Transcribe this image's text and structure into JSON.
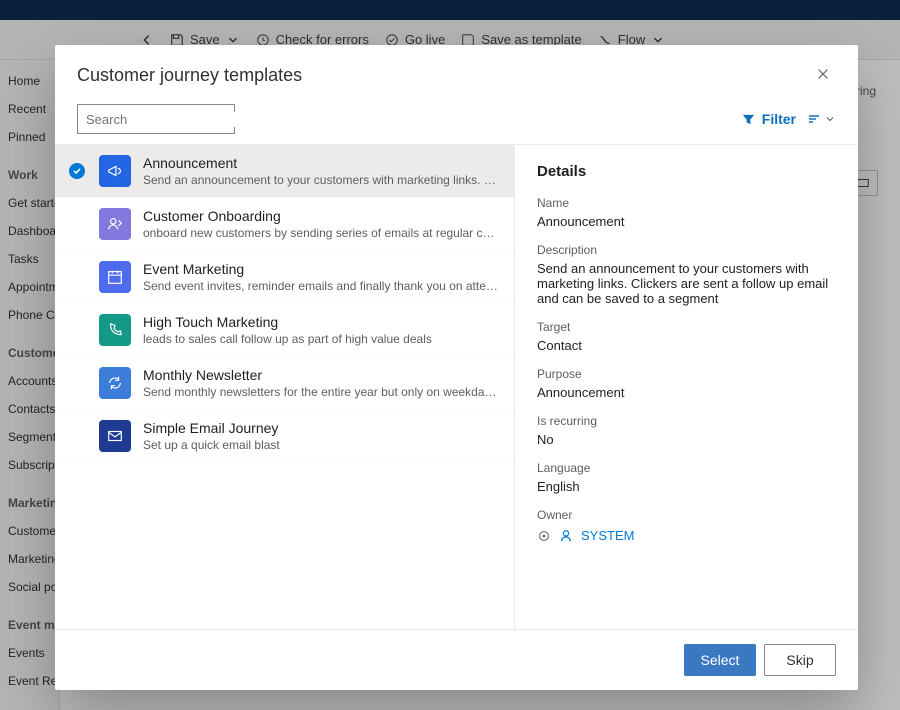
{
  "background": {
    "commands": {
      "save": "Save",
      "check": "Check for errors",
      "golive": "Go live",
      "saveas": "Save as template",
      "flow": "Flow"
    },
    "sidebar": {
      "home": "Home",
      "recent": "Recent",
      "pinned": "Pinned",
      "section_work": "Work",
      "getstarted": "Get started",
      "dashboards": "Dashboards",
      "tasks": "Tasks",
      "appointments": "Appointments",
      "phonecalls": "Phone Calls",
      "section_customers": "Customers",
      "accounts": "Accounts",
      "contacts": "Contacts",
      "segments": "Segments",
      "subscriptions": "Subscriptions",
      "section_marketing": "Marketing execution",
      "customerjourneys": "Customer journeys",
      "marketingemails": "Marketing emails",
      "socialposts": "Social posts",
      "section_event": "Event management",
      "events": "Events",
      "eventreg": "Event Registrations"
    },
    "right_hint": "rring"
  },
  "modal": {
    "title": "Customer journey templates",
    "search_placeholder": "Search",
    "filter_label": "Filter",
    "templates": [
      {
        "name": "Announcement",
        "description": "Send an announcement to your customers with marketing links. Clickers are sent a…",
        "icon": "megaphone",
        "selected": true
      },
      {
        "name": "Customer Onboarding",
        "description": "onboard new customers by sending series of emails at regular cadence",
        "icon": "onboarding",
        "selected": false
      },
      {
        "name": "Event Marketing",
        "description": "Send event invites, reminder emails and finally thank you on attending",
        "icon": "calendar",
        "selected": false
      },
      {
        "name": "High Touch Marketing",
        "description": "leads to sales call follow up as part of high value deals",
        "icon": "phone",
        "selected": false
      },
      {
        "name": "Monthly Newsletter",
        "description": "Send monthly newsletters for the entire year but only on weekday afternoons",
        "icon": "refresh",
        "selected": false
      },
      {
        "name": "Simple Email Journey",
        "description": "Set up a quick email blast",
        "icon": "mail",
        "selected": false
      }
    ],
    "details": {
      "header": "Details",
      "labels": {
        "name": "Name",
        "description": "Description",
        "target": "Target",
        "purpose": "Purpose",
        "recurring": "Is recurring",
        "language": "Language",
        "owner": "Owner"
      },
      "values": {
        "name": "Announcement",
        "description": "Send an announcement to your customers with marketing links. Clickers are sent a follow up email and can be saved to a segment",
        "target": "Contact",
        "purpose": "Announcement",
        "recurring": "No",
        "language": "English",
        "owner": "SYSTEM"
      }
    },
    "buttons": {
      "select": "Select",
      "skip": "Skip"
    }
  },
  "colors": {
    "primary": "#0078d4",
    "selected_row": "#edebe9"
  }
}
